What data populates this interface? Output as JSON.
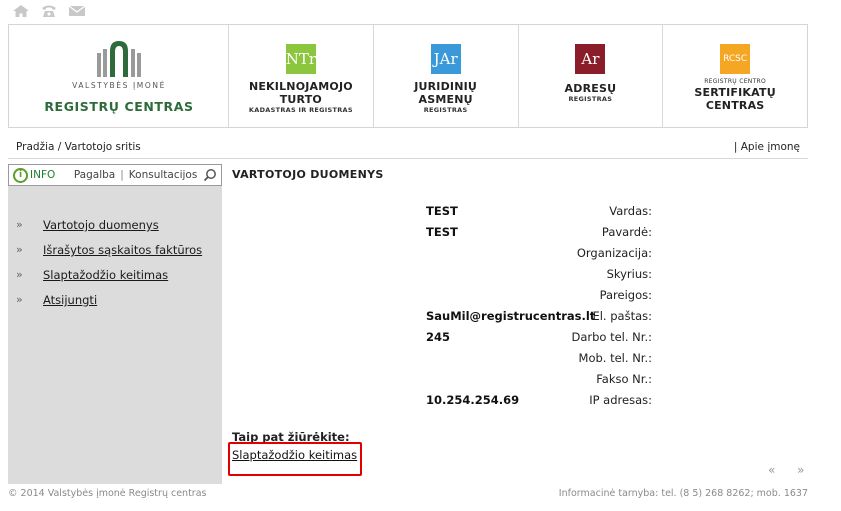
{
  "top_icons": [
    "home-icon",
    "phone-icon",
    "mail-icon"
  ],
  "logo": {
    "line1": "VALSTYBĖS ĮMONĖ",
    "line2": "REGISTRŲ CENTRAS",
    "color": "#2e6b3a"
  },
  "brands": [
    {
      "icon_text": "NTr",
      "color": "#8cc63f",
      "pre": "",
      "name": [
        "NEKILNOJAMOJO",
        "TURTO"
      ],
      "sub": "KADASTRAS IR REGISTRAS"
    },
    {
      "icon_text": "JAr",
      "color": "#3a9ad9",
      "pre": "",
      "name": [
        "JURIDINIŲ",
        "ASMENŲ"
      ],
      "sub": "REGISTRAS"
    },
    {
      "icon_text": "Ar",
      "color": "#8b1c2a",
      "pre": "",
      "name": [
        "ADRESŲ"
      ],
      "sub": "REGISTRAS"
    },
    {
      "icon_text": "RCSC",
      "color": "#f5a623",
      "pre": "REGISTRŲ CENTRO",
      "name": [
        "SERTIFIKATŲ",
        "CENTRAS"
      ],
      "sub": ""
    }
  ],
  "breadcrumb": "Pradžia / Vartotojo sritis",
  "about_link": "| Apie įmonę",
  "sidebar": {
    "info_label": "INFO",
    "help_label": "Pagalba",
    "consult_label": "Konsultacijos",
    "items": [
      {
        "bullet": "»",
        "label": "Vartotojo duomenys"
      },
      {
        "bullet": "»",
        "label": "Išrašytos sąskaitos faktūros"
      },
      {
        "bullet": "»",
        "label": "Slaptažodžio keitimas"
      },
      {
        "bullet": "»",
        "label": "Atsijungti"
      }
    ]
  },
  "main": {
    "title": "VARTOTOJO DUOMENYS",
    "fields": [
      {
        "label": "Vardas:",
        "value": "TEST"
      },
      {
        "label": "Pavardė:",
        "value": "TEST"
      },
      {
        "label": "Organizacija:",
        "value": ""
      },
      {
        "label": "Skyrius:",
        "value": ""
      },
      {
        "label": "Pareigos:",
        "value": ""
      },
      {
        "label": "El. paštas:",
        "value": "SauMil@registrucentras.lt"
      },
      {
        "label": "Darbo tel. Nr.:",
        "value": "245"
      },
      {
        "label": "Mob. tel. Nr.:",
        "value": ""
      },
      {
        "label": "Fakso Nr.:",
        "value": ""
      },
      {
        "label": "IP adresas:",
        "value": "10.254.254.69"
      }
    ],
    "see_also_title": "Taip pat žiūrėkite:",
    "see_also_link": "Slaptažodžio keitimas"
  },
  "pager": "« »",
  "footer": {
    "copyright": "© 2014 Valstybės įmonė Registrų centras",
    "contact": "Informacinė tarnyba: tel. (8 5) 268 8262; mob. 1637"
  }
}
